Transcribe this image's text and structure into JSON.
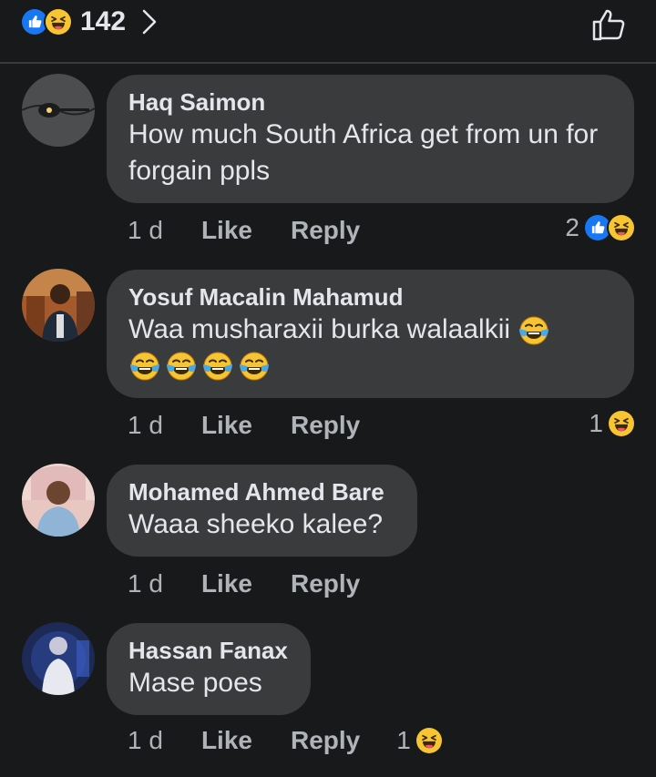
{
  "header": {
    "reaction_count": "142",
    "reaction_icons": [
      "like-icon",
      "haha-icon"
    ],
    "chevron_icon": "chevron-right-icon",
    "like_button_icon": "thumbs-up-outline-icon"
  },
  "actions": {
    "like_label": "Like",
    "reply_label": "Reply"
  },
  "colors": {
    "background": "#18191a",
    "bubble": "#3a3b3c",
    "like_blue": "#1877f2",
    "haha_yellow": "#f7c531"
  },
  "comments": [
    {
      "author": "Haq Saimon",
      "text": "How much South Africa  get from un for forgain ppls",
      "time": "1 d",
      "reaction_count": "2",
      "reactions": [
        "like-icon",
        "haha-icon"
      ]
    },
    {
      "author": "Yosuf Macalin Mahamud",
      "text": "Waa musharaxii burka walaalkii",
      "trailing_emoji": [
        "tears-of-joy-icon",
        "tears-of-joy-icon",
        "tears-of-joy-icon",
        "tears-of-joy-icon",
        "tears-of-joy-icon"
      ],
      "time": "1 d",
      "reaction_count": "1",
      "reactions": [
        "haha-icon"
      ]
    },
    {
      "author": "Mohamed Ahmed Bare",
      "text": "Waaa sheeko kalee?",
      "time": "1 d"
    },
    {
      "author": "Hassan Fanax",
      "text": "Mase poes",
      "time": "1 d",
      "reaction_count": "1",
      "reactions": [
        "haha-icon"
      ]
    }
  ]
}
